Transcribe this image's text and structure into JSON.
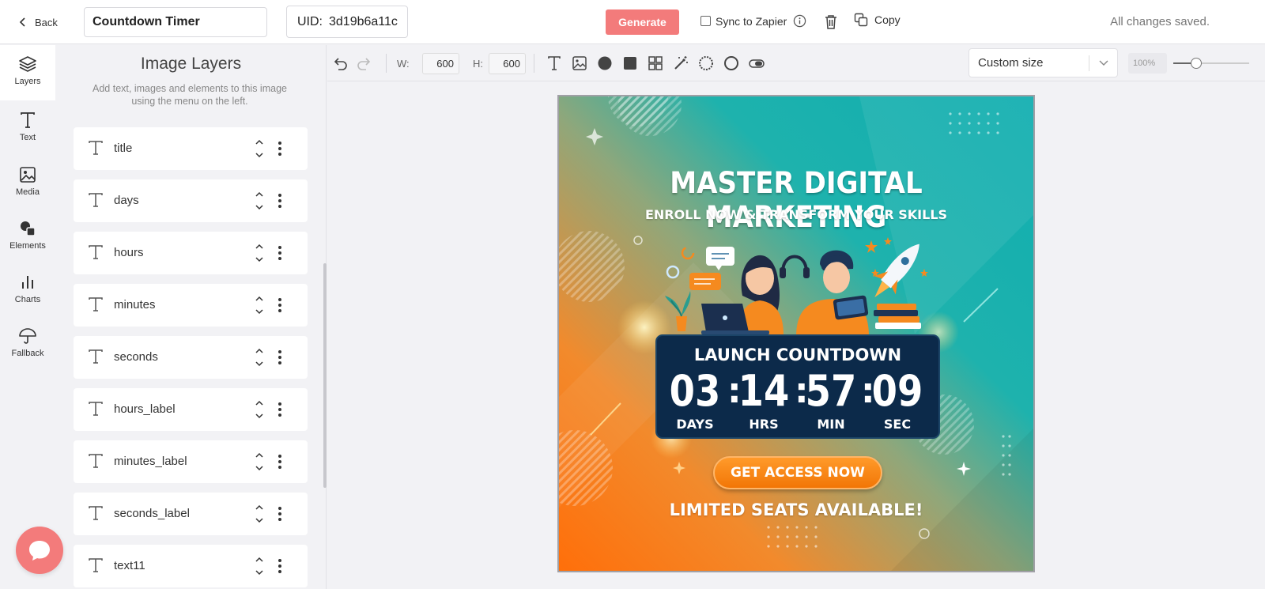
{
  "header": {
    "back_label": "Back",
    "template_name": "Countdown Timer",
    "uid_label": "UID:",
    "uid_value": "3d19b6a11c",
    "generate_label": "Generate",
    "sync_label": "Sync to Zapier",
    "sync_checked": false,
    "copy_label": "Copy",
    "status": "All changes saved."
  },
  "rail": {
    "items": [
      {
        "label": "Layers",
        "icon": "layers-icon",
        "active": true
      },
      {
        "label": "Text",
        "icon": "text-icon"
      },
      {
        "label": "Media",
        "icon": "image-icon"
      },
      {
        "label": "Elements",
        "icon": "shapes-icon"
      },
      {
        "label": "Charts",
        "icon": "bar-chart-icon"
      },
      {
        "label": "Fallback",
        "icon": "umbrella-icon"
      }
    ]
  },
  "layers_panel": {
    "title": "Image Layers",
    "description": "Add text, images and elements to this image using the menu on the left.",
    "layers": [
      "title",
      "days",
      "hours",
      "minutes",
      "seconds",
      "hours_label",
      "minutes_label",
      "seconds_label",
      "text11"
    ]
  },
  "toolbar": {
    "width_label": "W:",
    "width_value": "600",
    "height_label": "H:",
    "height_value": "600",
    "size_preset": "Custom size",
    "zoom": "100%",
    "zoom_slider_fraction": 0.3
  },
  "poster": {
    "title": "MASTER DIGITAL MARKETING",
    "subtitle": "ENROLL NOW & TRANSFORM YOUR SKILLS",
    "countdown_title": "LAUNCH COUNTDOWN",
    "days": "03",
    "hours": "14",
    "minutes": "57",
    "seconds": "09",
    "days_label": "DAYS",
    "hours_label": "HRS",
    "minutes_label": "MIN",
    "seconds_label": "SEC",
    "cta": "GET ACCESS NOW",
    "footer": "LIMITED SEATS AVAILABLE!"
  },
  "colors": {
    "accent": "#f37b7b",
    "countdown_bg": "#0c2a4a",
    "cta_orange": "#f27606",
    "poster_teal": "#10aeb0",
    "poster_orange": "#ff6f0a"
  }
}
